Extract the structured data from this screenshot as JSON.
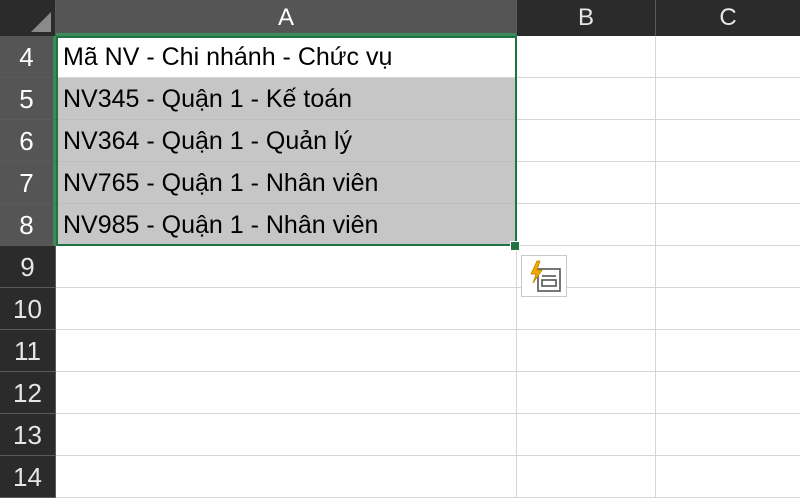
{
  "columns": [
    "A",
    "B",
    "C"
  ],
  "rows": [
    "4",
    "5",
    "6",
    "7",
    "8",
    "9",
    "10",
    "11",
    "12",
    "13",
    "14"
  ],
  "cells": {
    "a4": "Mã NV - Chi nhánh - Chức vụ",
    "a5": "NV345 - Quận 1 - Kế toán",
    "a6": "NV364 - Quận 1 - Quản lý",
    "a7": "NV765 - Quận 1 - Nhân viên",
    "a8": "NV985 - Quận 1 - Nhân viên"
  },
  "flash_fill_icon": "flash-fill-options-icon",
  "colors": {
    "header_bg": "#2b2b2b",
    "header_selected_bg": "#555555",
    "selection_border": "#217346",
    "filled_cell_bg": "#c6c6c6"
  }
}
